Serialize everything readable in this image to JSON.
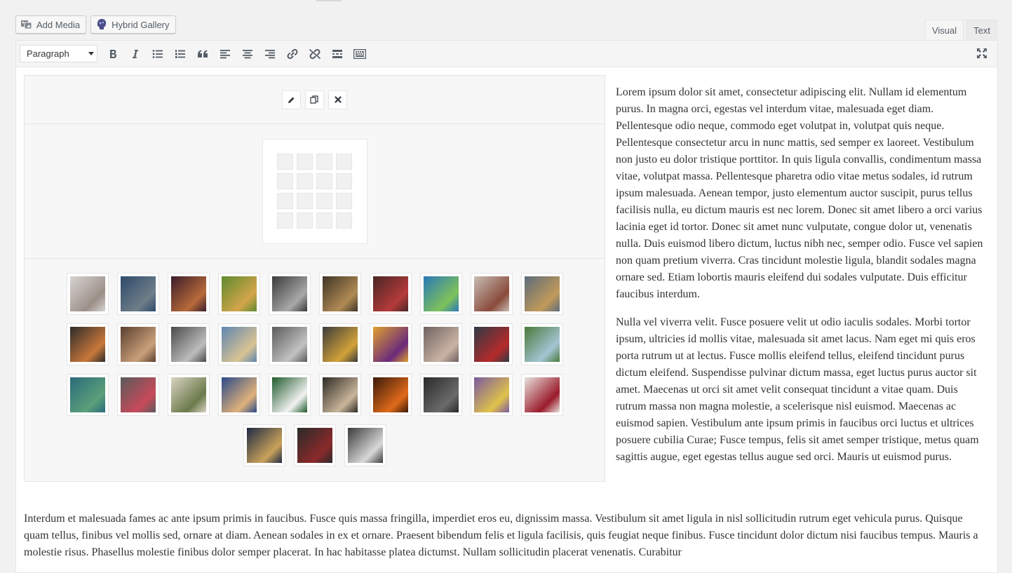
{
  "media_buttons": {
    "add_media": "Add Media",
    "hybrid_gallery": "Hybrid Gallery"
  },
  "tabs": {
    "visual": "Visual",
    "text": "Text"
  },
  "toolbar": {
    "format_value": "Paragraph"
  },
  "gallery": {
    "rows": [
      [
        {
          "c1": "#d7d4d2",
          "c2": "#9c8f88"
        },
        {
          "c1": "#2d4a6b",
          "c2": "#6f7e88"
        },
        {
          "c1": "#3b1d2c",
          "c2": "#b86a3a"
        },
        {
          "c1": "#5d8a2f",
          "c2": "#d4a54a"
        },
        {
          "c1": "#3a3a3a",
          "c2": "#a9a9a9"
        },
        {
          "c1": "#3e3526",
          "c2": "#b08a54"
        },
        {
          "c1": "#4a2626",
          "c2": "#b53a3a"
        },
        {
          "c1": "#2a78b8",
          "c2": "#7ec25a"
        },
        {
          "c1": "#c7bdb5",
          "c2": "#8a4a3a"
        },
        {
          "c1": "#5c6b7a",
          "c2": "#c29a5a"
        }
      ],
      [
        {
          "c1": "#2b2b2b",
          "c2": "#c9783a"
        },
        {
          "c1": "#5a3f2e",
          "c2": "#c9a07a"
        },
        {
          "c1": "#4a4a4a",
          "c2": "#bdbdbd"
        },
        {
          "c1": "#5f86b0",
          "c2": "#d8c394"
        },
        {
          "c1": "#5a5a5a",
          "c2": "#c2c2c2"
        },
        {
          "c1": "#3b3b3b",
          "c2": "#d2a23a"
        },
        {
          "c1": "#e0a030",
          "c2": "#6a2a7a"
        },
        {
          "c1": "#6f6260",
          "c2": "#c9b3a4"
        },
        {
          "c1": "#2e3a44",
          "c2": "#b52a2a"
        },
        {
          "c1": "#4a7a3a",
          "c2": "#a4c4d4"
        }
      ],
      [
        {
          "c1": "#2a6a7a",
          "c2": "#5aa07a"
        },
        {
          "c1": "#5a5a5a",
          "c2": "#c84a5a"
        },
        {
          "c1": "#d9d3c4",
          "c2": "#6a7a4a"
        },
        {
          "c1": "#2a4a8a",
          "c2": "#e0b27a"
        },
        {
          "c1": "#1f5a2a",
          "c2": "#f2f2f2"
        },
        {
          "c1": "#2e2a24",
          "c2": "#c9b59a"
        },
        {
          "c1": "#3a1a0a",
          "c2": "#e06a1a"
        },
        {
          "c1": "#2a2a2a",
          "c2": "#6a6a6a"
        },
        {
          "c1": "#7a5aa0",
          "c2": "#e0c24a"
        },
        {
          "c1": "#e8e2dc",
          "c2": "#9a1a2a"
        }
      ],
      [
        {
          "c1": "#1e2a44",
          "c2": "#c9a25a"
        },
        {
          "c1": "#2a2a2a",
          "c2": "#8a2a2a"
        },
        {
          "c1": "#3a3a3a",
          "c2": "#d8d8d8"
        }
      ]
    ]
  },
  "side_paragraphs": [
    "Lorem ipsum dolor sit amet, consectetur adipiscing elit. Nullam id elementum purus. In magna orci, egestas vel interdum vitae, malesuada eget diam. Pellentesque odio neque, commodo eget volutpat in, volutpat quis neque. Pellentesque consectetur arcu in nunc mattis, sed semper ex laoreet. Vestibulum non justo eu dolor tristique porttitor. In quis ligula convallis, condimentum massa vitae, volutpat massa. Pellentesque pharetra odio vitae metus sodales, id rutrum ipsum malesuada. Aenean tempor, justo elementum auctor suscipit, purus tellus facilisis nulla, eu dictum mauris est nec lorem. Donec sit amet libero a orci varius lacinia eget id tortor. Donec sit amet nunc vulputate, congue dolor ut, venenatis nulla. Duis euismod libero dictum, luctus nibh nec, semper odio. Fusce vel sapien non quam pretium viverra. Cras tincidunt molestie ligula, blandit sodales magna ornare sed. Etiam lobortis mauris eleifend dui sodales vulputate. Duis efficitur faucibus interdum.",
    "Nulla vel viverra velit. Fusce posuere velit ut odio iaculis sodales. Morbi tortor ipsum, ultricies id mollis vitae, malesuada sit amet lacus. Nam eget mi quis eros porta rutrum ut at lectus. Fusce mollis eleifend tellus, eleifend tincidunt purus dictum eleifend. Suspendisse pulvinar dictum massa, eget luctus purus auctor sit amet. Maecenas ut orci sit amet velit consequat tincidunt a vitae quam. Duis rutrum massa non magna molestie, a scelerisque nisl euismod. Maecenas ac euismod sapien. Vestibulum ante ipsum primis in faucibus orci luctus et ultrices posuere cubilia Curae; Fusce tempus, felis sit amet semper tristique, metus quam sagittis augue, eget egestas tellus augue sed orci. Mauris ut euismod purus."
  ],
  "bottom_paragraph": "Interdum et malesuada fames ac ante ipsum primis in faucibus. Fusce quis massa fringilla, imperdiet eros eu, dignissim massa. Vestibulum sit amet ligula in nisl sollicitudin rutrum eget vehicula purus. Quisque quam tellus, finibus vel mollis sed, ornare at diam. Aenean sodales in ex et ornare. Praesent bibendum felis et ligula facilisis, quis feugiat neque finibus. Fusce tincidunt dolor dictum nisi faucibus tempus. Mauris a molestie risus. Phasellus molestie finibus dolor semper placerat. In hac habitasse platea dictumst. Nullam sollicitudin placerat venenatis. Curabitur"
}
